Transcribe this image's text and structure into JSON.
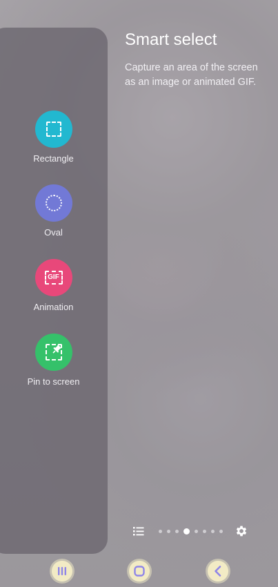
{
  "edge_panel": {
    "tools": [
      {
        "label": "Rectangle",
        "icon": "rectangle-select-icon",
        "color": "#22b8d0"
      },
      {
        "label": "Oval",
        "icon": "oval-select-icon",
        "color": "#7279d6"
      },
      {
        "label": "Animation",
        "icon": "gif-icon",
        "color": "#e8487a"
      },
      {
        "label": "Pin to screen",
        "icon": "pin-to-screen-icon",
        "color": "#35c16a"
      }
    ],
    "gif_text": "GIF"
  },
  "info": {
    "title": "Smart select",
    "description": "Capture an area of the screen as an image or animated GIF."
  },
  "footer": {
    "page_count": 8,
    "active_page": 4,
    "list_icon": "list-icon",
    "settings_icon": "gear-icon"
  },
  "navbar": {
    "buttons": [
      "recents-icon",
      "home-icon",
      "back-icon"
    ],
    "button_color": "#f2ebc5",
    "icon_color": "#8f86e8"
  }
}
